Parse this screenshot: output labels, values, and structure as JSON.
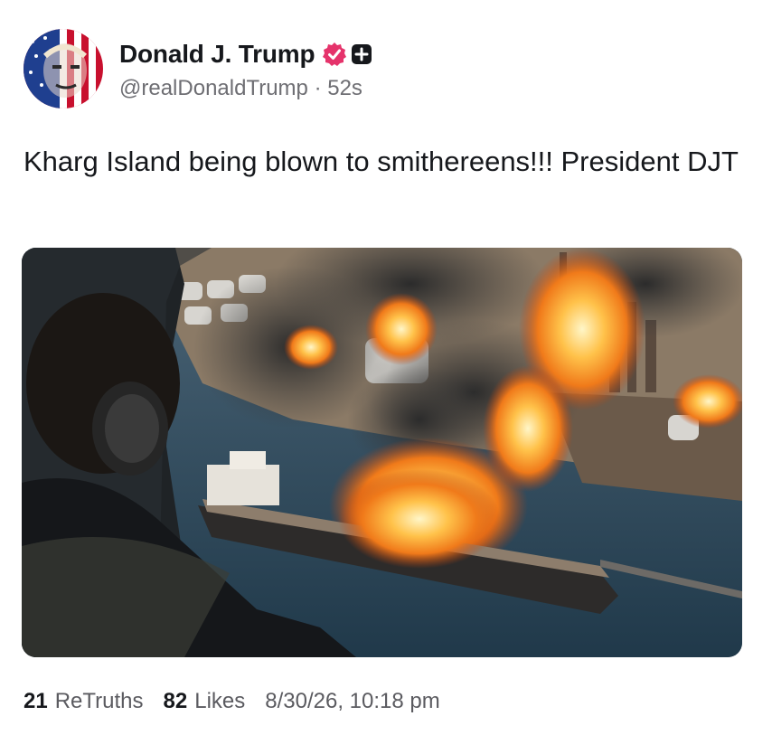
{
  "post": {
    "author": {
      "display_name": "Donald J. Trump",
      "handle": "@realDonaldTrump",
      "time_separator": "·",
      "time_ago": "52s",
      "verified_icon": "verified-check-badge",
      "extra_icon": "plus-square-icon"
    },
    "text": "Kharg Island being blown to smithereens!!! President DJT",
    "media": {
      "kind": "image",
      "description_icon": "photo"
    },
    "stats": {
      "retruths_count": "21",
      "retruths_label": "ReTruths",
      "likes_count": "82",
      "likes_label": "Likes",
      "timestamp": "8/30/26, 10:18 pm"
    }
  },
  "colors": {
    "verified_badge": "#e5336b",
    "text_primary": "#16181c",
    "text_secondary": "#6e6e73"
  }
}
